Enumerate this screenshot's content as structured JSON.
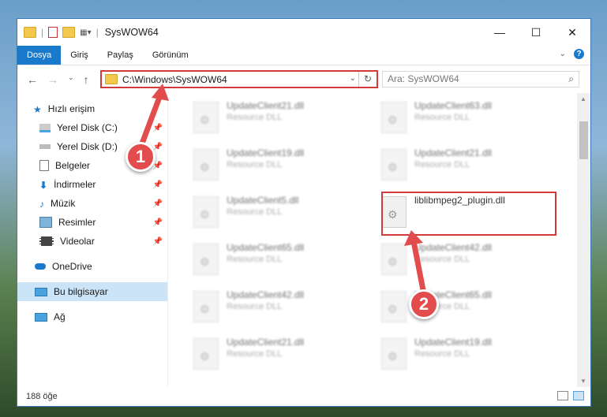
{
  "window": {
    "title": "SysWOW64",
    "buttons": {
      "minimize": "—",
      "maximize": "☐",
      "close": "✕"
    }
  },
  "ribbon": {
    "tabs": [
      {
        "label": "Dosya",
        "active": true
      },
      {
        "label": "Giriş"
      },
      {
        "label": "Paylaş"
      },
      {
        "label": "Görünüm"
      }
    ],
    "help": "?"
  },
  "address": {
    "path": "C:\\Windows\\SysWOW64",
    "search_placeholder": "Ara: SysWOW64"
  },
  "sidebar": {
    "items": [
      {
        "label": "Hızlı erişim",
        "icon": "star-icon"
      },
      {
        "label": "Yerel Disk (C:)",
        "icon": "drive-icon"
      },
      {
        "label": "Yerel Disk (D:)",
        "icon": "drive-icon"
      },
      {
        "label": "Belgeler",
        "icon": "document-icon"
      },
      {
        "label": "İndirmeler",
        "icon": "download-icon"
      },
      {
        "label": "Müzik",
        "icon": "music-icon"
      },
      {
        "label": "Resimler",
        "icon": "pictures-icon"
      },
      {
        "label": "Videolar",
        "icon": "video-icon"
      },
      {
        "label": "OneDrive",
        "icon": "cloud-icon"
      },
      {
        "label": "Bu bilgisayar",
        "icon": "computer-icon"
      },
      {
        "label": "Ağ",
        "icon": "network-icon"
      }
    ]
  },
  "files": {
    "left": [
      {
        "name": "UpdateClient21.dll",
        "type": "Resource DLL"
      },
      {
        "name": "UpdateClient19.dll",
        "type": "Resource DLL"
      },
      {
        "name": "UpdateClient5.dll",
        "type": "Resource DLL"
      },
      {
        "name": "UpdateClient65.dll",
        "type": "Resource DLL"
      },
      {
        "name": "UpdateClient42.dll",
        "type": "Resource DLL"
      },
      {
        "name": "UpdateClient21.dll",
        "type": "Resource DLL"
      }
    ],
    "right": [
      {
        "name": "UpdateClient63.dll",
        "type": "Resource DLL"
      },
      {
        "name": "UpdateClient21.dll",
        "type": "Resource DLL"
      },
      {
        "name": "liblibmpeg2_plugin.dll",
        "type": ""
      },
      {
        "name": "UpdateClient42.dll",
        "type": "Resource DLL"
      },
      {
        "name": "UpdateClient65.dll",
        "type": "Resource DLL"
      },
      {
        "name": "UpdateClient19.dll",
        "type": "Resource DLL"
      }
    ]
  },
  "status": {
    "count": "188 öğe"
  },
  "annotations": {
    "step1": "1",
    "step2": "2"
  }
}
